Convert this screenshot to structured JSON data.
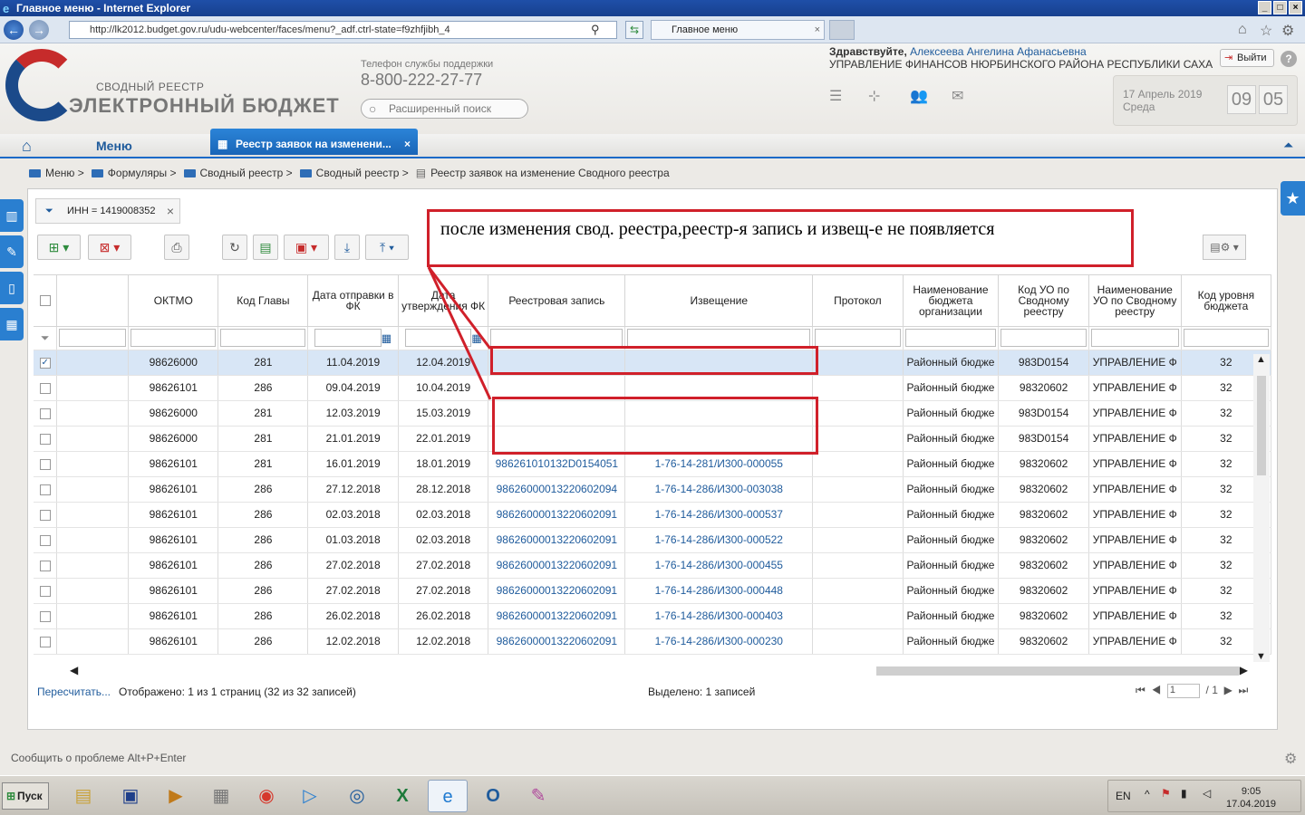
{
  "window": {
    "title": "Главное меню - Internet Explorer"
  },
  "browser": {
    "address": "http://lk2012.budget.gov.ru/udu-webcenter/faces/menu?_adf.ctrl-state=f9zhfjibh_4",
    "tab_title": "Главное меню"
  },
  "header": {
    "logo_line1": "СВОДНЫЙ РЕЕСТР",
    "logo_line2": "ЭЛЕКТРОННЫЙ БЮДЖЕТ",
    "support_label": "Телефон службы поддержки",
    "support_phone": "8-800-222-27-77",
    "search_placeholder": "Расширенный поиск",
    "greeting_prefix": "Здравствуйте,",
    "user_name": "Алексеева Ангелина Афанасьевна",
    "org_name": "УПРАВЛЕНИЕ ФИНАНСОВ НЮРБИНСКОГО РАЙОНА РЕСПУБЛИКИ САХА",
    "logout_label": "Выйти",
    "date_line1": "17 Апрель 2019",
    "date_line2": "Среда",
    "clock_hours": "09",
    "clock_minutes": "05"
  },
  "menu": {
    "menu_label": "Меню",
    "active_tab": "Реестр заявок на изменени..."
  },
  "breadcrumb": [
    "Меню >",
    "Формуляры >",
    "Сводный реестр >",
    "Сводный реестр >",
    "Реестр заявок на изменение Сводного реестра"
  ],
  "filter": {
    "chip_label": "ИНН = 1419008352"
  },
  "annotation": {
    "text": "после изменения свод. реестра,реестр-я запись и извещ-е не появляется"
  },
  "grid": {
    "columns": [
      "ОКТМО",
      "Код Главы",
      "Дата отправки в ФК",
      "Дата утверждения ФК",
      "Реестровая запись",
      "Извещение",
      "Протокол",
      "Наименование бюджета организации",
      "Код УО по Сводному реестру",
      "Наименование УО по Сводному реестру",
      "Код уровня бюджета"
    ],
    "rows": [
      {
        "checked": true,
        "oktmo": "98626000",
        "kod": "281",
        "sent": "11.04.2019",
        "approved": "12.04.2019",
        "record": "",
        "notice": "",
        "protocol": "",
        "budget": "Районный бюдже",
        "uo_code": "983D0154",
        "uo_name": "УПРАВЛЕНИЕ Ф",
        "level": "32"
      },
      {
        "checked": false,
        "oktmo": "98626101",
        "kod": "286",
        "sent": "09.04.2019",
        "approved": "10.04.2019",
        "record": "",
        "notice": "",
        "protocol": "",
        "budget": "Районный бюдже",
        "uo_code": "98320602",
        "uo_name": "УПРАВЛЕНИЕ Ф",
        "level": "32"
      },
      {
        "checked": false,
        "oktmo": "98626000",
        "kod": "281",
        "sent": "12.03.2019",
        "approved": "15.03.2019",
        "record": "",
        "notice": "",
        "protocol": "",
        "budget": "Районный бюдже",
        "uo_code": "983D0154",
        "uo_name": "УПРАВЛЕНИЕ Ф",
        "level": "32"
      },
      {
        "checked": false,
        "oktmo": "98626000",
        "kod": "281",
        "sent": "21.01.2019",
        "approved": "22.01.2019",
        "record": "",
        "notice": "",
        "protocol": "",
        "budget": "Районный бюдже",
        "uo_code": "983D0154",
        "uo_name": "УПРАВЛЕНИЕ Ф",
        "level": "32"
      },
      {
        "checked": false,
        "oktmo": "98626101",
        "kod": "281",
        "sent": "16.01.2019",
        "approved": "18.01.2019",
        "record": "986261010132D0154051",
        "notice": "1-76-14-281/И300-000055",
        "protocol": "",
        "budget": "Районный бюдже",
        "uo_code": "98320602",
        "uo_name": "УПРАВЛЕНИЕ Ф",
        "level": "32"
      },
      {
        "checked": false,
        "oktmo": "98626101",
        "kod": "286",
        "sent": "27.12.2018",
        "approved": "28.12.2018",
        "record": "98626000013220602094",
        "notice": "1-76-14-286/И300-003038",
        "protocol": "",
        "budget": "Районный бюдже",
        "uo_code": "98320602",
        "uo_name": "УПРАВЛЕНИЕ Ф",
        "level": "32"
      },
      {
        "checked": false,
        "oktmo": "98626101",
        "kod": "286",
        "sent": "02.03.2018",
        "approved": "02.03.2018",
        "record": "98626000013220602091",
        "notice": "1-76-14-286/И300-000537",
        "protocol": "",
        "budget": "Районный бюдже",
        "uo_code": "98320602",
        "uo_name": "УПРАВЛЕНИЕ Ф",
        "level": "32"
      },
      {
        "checked": false,
        "oktmo": "98626101",
        "kod": "286",
        "sent": "01.03.2018",
        "approved": "02.03.2018",
        "record": "98626000013220602091",
        "notice": "1-76-14-286/И300-000522",
        "protocol": "",
        "budget": "Районный бюдже",
        "uo_code": "98320602",
        "uo_name": "УПРАВЛЕНИЕ Ф",
        "level": "32"
      },
      {
        "checked": false,
        "oktmo": "98626101",
        "kod": "286",
        "sent": "27.02.2018",
        "approved": "27.02.2018",
        "record": "98626000013220602091",
        "notice": "1-76-14-286/И300-000455",
        "protocol": "",
        "budget": "Районный бюдже",
        "uo_code": "98320602",
        "uo_name": "УПРАВЛЕНИЕ Ф",
        "level": "32"
      },
      {
        "checked": false,
        "oktmo": "98626101",
        "kod": "286",
        "sent": "27.02.2018",
        "approved": "27.02.2018",
        "record": "98626000013220602091",
        "notice": "1-76-14-286/И300-000448",
        "protocol": "",
        "budget": "Районный бюдже",
        "uo_code": "98320602",
        "uo_name": "УПРАВЛЕНИЕ Ф",
        "level": "32"
      },
      {
        "checked": false,
        "oktmo": "98626101",
        "kod": "286",
        "sent": "26.02.2018",
        "approved": "26.02.2018",
        "record": "98626000013220602091",
        "notice": "1-76-14-286/И300-000403",
        "protocol": "",
        "budget": "Районный бюдже",
        "uo_code": "98320602",
        "uo_name": "УПРАВЛЕНИЕ Ф",
        "level": "32"
      },
      {
        "checked": false,
        "oktmo": "98626101",
        "kod": "286",
        "sent": "12.02.2018",
        "approved": "12.02.2018",
        "record": "98626000013220602091",
        "notice": "1-76-14-286/И300-000230",
        "protocol": "",
        "budget": "Районный бюдже",
        "uo_code": "98320602",
        "uo_name": "УПРАВЛЕНИЕ Ф",
        "level": "32"
      }
    ]
  },
  "status": {
    "recalc": "Пересчитать...",
    "shown": "Отображено: 1 из 1 страниц (32 из 32 записей)",
    "selected": "Выделено: 1 записей",
    "page_current": "1",
    "page_total": "/ 1"
  },
  "footer": {
    "report": "Сообщить о проблеме Alt+P+Enter"
  },
  "taskbar": {
    "start": "Пуск",
    "lang": "EN",
    "time": "9:05",
    "date": "17.04.2019"
  },
  "colors": {
    "accent": "#1a65b7",
    "annotation": "#d0202a",
    "link": "#1f5b9c"
  }
}
